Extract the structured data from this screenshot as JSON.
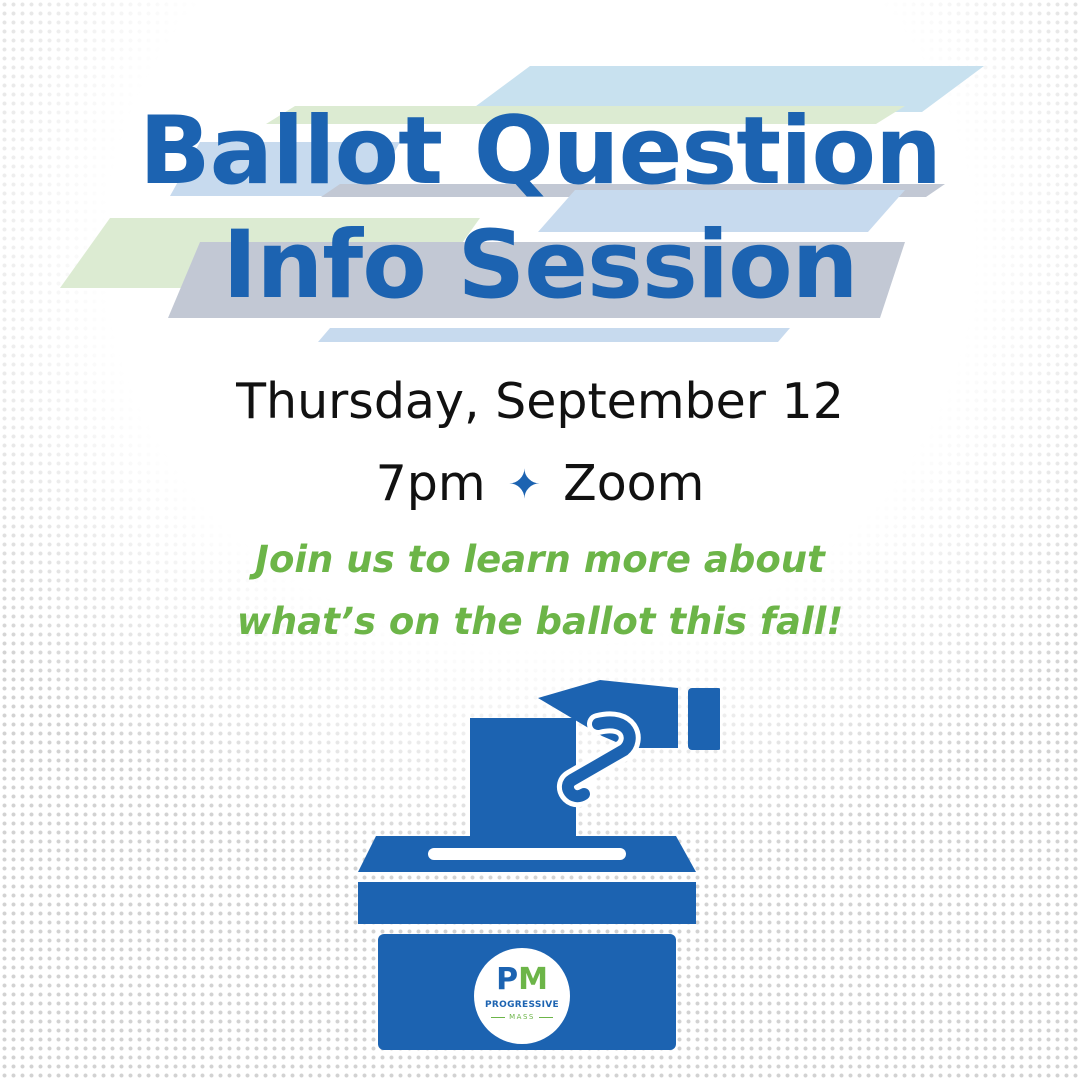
{
  "title": {
    "line1": "Ballot Question",
    "line2": "Info Session"
  },
  "event": {
    "date": "Thursday, September 12",
    "time": "7pm",
    "separator": "✦",
    "location": "Zoom"
  },
  "tagline": {
    "line1": "Join us to learn more about",
    "line2": "what’s on the ballot this fall!"
  },
  "logo": {
    "mark_p": "P",
    "mark_m": "M",
    "name": "PROGRESSIVE",
    "sub": "MASS"
  },
  "icons": {
    "separator": "sparkle-icon",
    "illustration": "ballot-box-icon"
  },
  "colors": {
    "brand_blue": "#1c63b1",
    "brand_green": "#6cb548",
    "text_dark": "#111111",
    "stripe_light_blue": "#c5dff0",
    "stripe_light_green": "#ddecd4",
    "stripe_gray": "#c2c8d4"
  }
}
